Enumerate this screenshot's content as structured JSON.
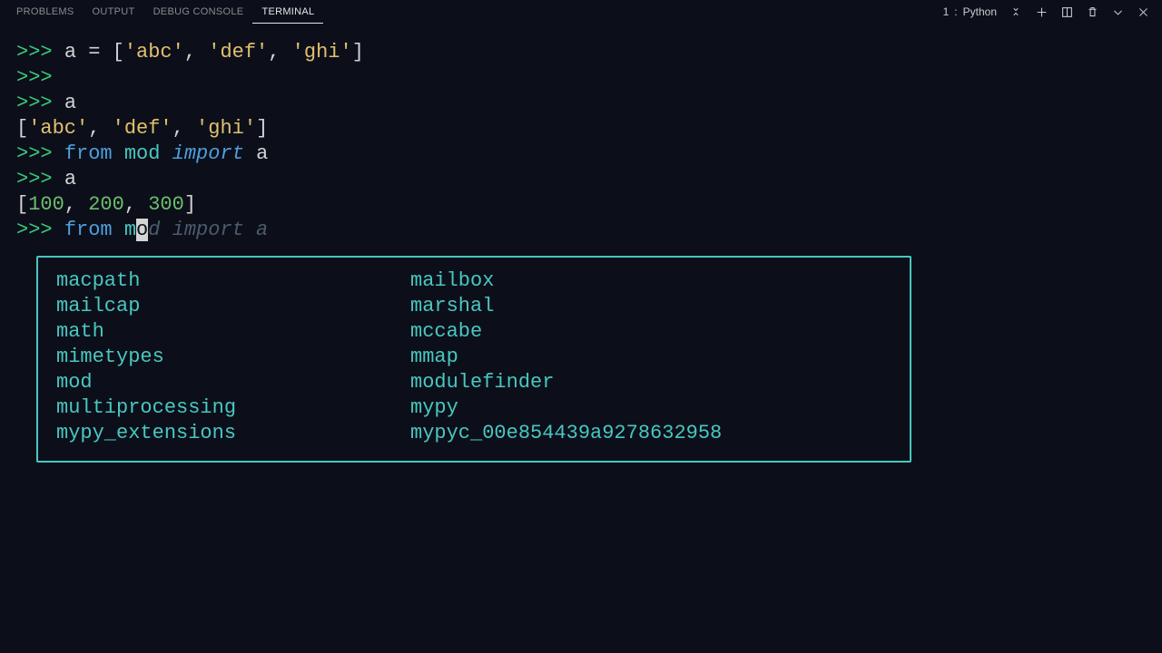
{
  "tabs": {
    "items": [
      "PROBLEMS",
      "OUTPUT",
      "DEBUG CONSOLE",
      "TERMINAL"
    ],
    "active_index": 3
  },
  "session": {
    "index": "1",
    "name": "Python"
  },
  "lines": [
    {
      "prompt": ">>> ",
      "segs": [
        {
          "t": "a ",
          "c": "var"
        },
        {
          "t": "=",
          "c": "op"
        },
        {
          "t": " [",
          "c": "var"
        },
        {
          "t": "'abc'",
          "c": "str"
        },
        {
          "t": ", ",
          "c": "var"
        },
        {
          "t": "'def'",
          "c": "str"
        },
        {
          "t": ", ",
          "c": "var"
        },
        {
          "t": "'ghi'",
          "c": "str"
        },
        {
          "t": "]",
          "c": "var"
        }
      ]
    },
    {
      "prompt": ">>> ",
      "segs": []
    },
    {
      "prompt": ">>> ",
      "segs": [
        {
          "t": "a",
          "c": "var"
        }
      ]
    },
    {
      "prompt": "",
      "segs": [
        {
          "t": "[",
          "c": "var"
        },
        {
          "t": "'abc'",
          "c": "str"
        },
        {
          "t": ", ",
          "c": "var"
        },
        {
          "t": "'def'",
          "c": "str"
        },
        {
          "t": ", ",
          "c": "var"
        },
        {
          "t": "'ghi'",
          "c": "str"
        },
        {
          "t": "]",
          "c": "var"
        }
      ]
    },
    {
      "prompt": ">>> ",
      "segs": [
        {
          "t": "from",
          "c": "kw"
        },
        {
          "t": " ",
          "c": "var"
        },
        {
          "t": "mod",
          "c": "id"
        },
        {
          "t": " ",
          "c": "var"
        },
        {
          "t": "import",
          "c": "kw-i"
        },
        {
          "t": " ",
          "c": "var"
        },
        {
          "t": "a",
          "c": "var"
        }
      ]
    },
    {
      "prompt": ">>> ",
      "segs": [
        {
          "t": "a",
          "c": "var"
        }
      ]
    },
    {
      "prompt": "",
      "segs": [
        {
          "t": "[",
          "c": "var"
        },
        {
          "t": "100",
          "c": "num"
        },
        {
          "t": ", ",
          "c": "var"
        },
        {
          "t": "200",
          "c": "num"
        },
        {
          "t": ", ",
          "c": "var"
        },
        {
          "t": "300",
          "c": "num"
        },
        {
          "t": "]",
          "c": "var"
        }
      ]
    },
    {
      "prompt": ">>> ",
      "segs": [
        {
          "t": "from",
          "c": "kw"
        },
        {
          "t": " ",
          "c": "var"
        },
        {
          "t": "m",
          "c": "id"
        },
        {
          "t": "o",
          "c": "cursor"
        },
        {
          "t": "d import a",
          "c": "ghost"
        }
      ]
    }
  ],
  "completion": {
    "columns": [
      [
        "macpath",
        "mailcap",
        "math",
        "mimetypes",
        "mod",
        "multiprocessing",
        "mypy_extensions"
      ],
      [
        "mailbox",
        "marshal",
        "mccabe",
        "mmap",
        "modulefinder",
        "mypy",
        "mypyc_00e854439a9278632958"
      ]
    ]
  }
}
